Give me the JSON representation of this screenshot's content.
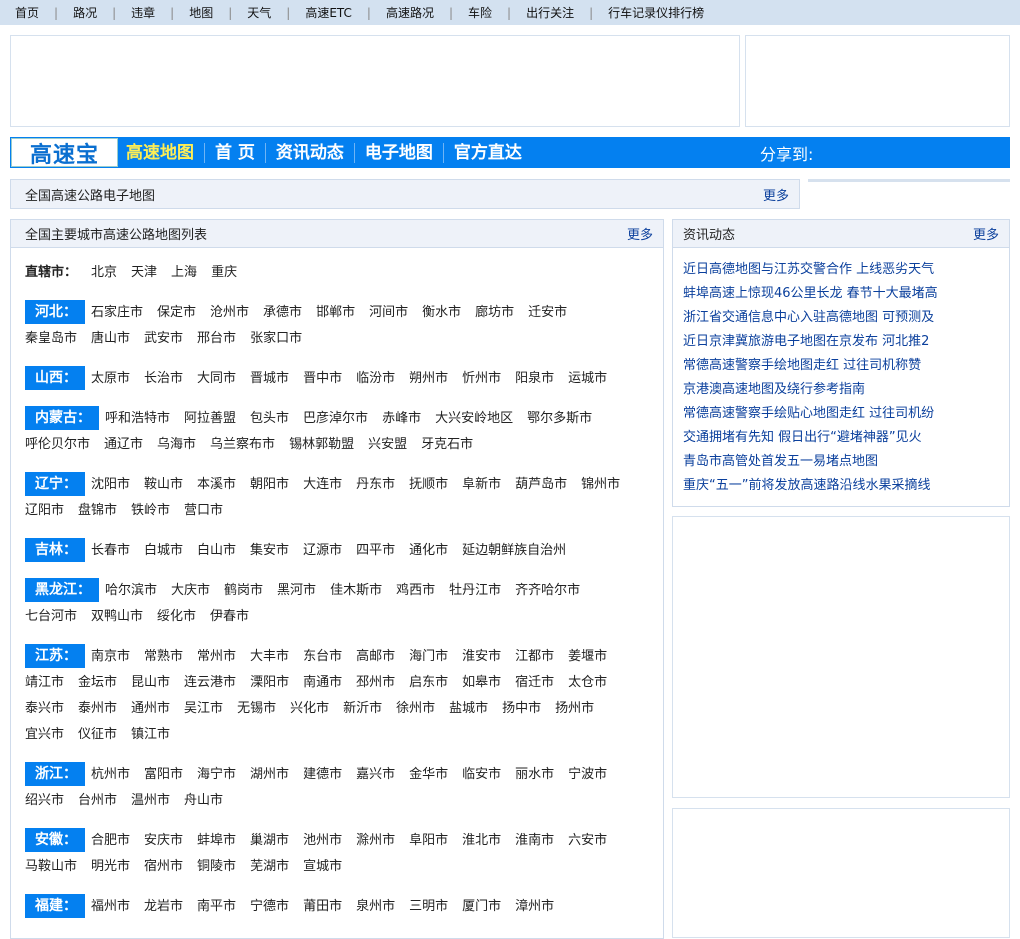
{
  "topnav": [
    "首页",
    "路况",
    "违章",
    "地图",
    "天气",
    "高速ETC",
    "高速路况",
    "车险",
    "出行关注",
    "行车记录仪排行榜"
  ],
  "mainnav": {
    "logo": "高速宝",
    "items": [
      "高速地图",
      "首 页",
      "资讯动态",
      "电子地图",
      "官方直达"
    ],
    "share": "分享到:"
  },
  "map_bar": {
    "title": "全国高速公路电子地图",
    "more": "更多"
  },
  "city_panel": {
    "title": "全国主要城市高速公路地图列表",
    "more": "更多",
    "direct": {
      "label": "直辖市：",
      "cities": [
        "北京",
        "天津",
        "上海",
        "重庆"
      ]
    },
    "provinces": [
      {
        "label": "河北：",
        "cities": [
          "石家庄市",
          "保定市",
          "沧州市",
          "承德市",
          "邯郸市",
          "河间市",
          "衡水市",
          "廊坊市",
          "迁安市",
          "秦皇岛市",
          "唐山市",
          "武安市",
          "邢台市",
          "张家口市"
        ]
      },
      {
        "label": "山西：",
        "cities": [
          "太原市",
          "长治市",
          "大同市",
          "晋城市",
          "晋中市",
          "临汾市",
          "朔州市",
          "忻州市",
          "阳泉市",
          "运城市"
        ]
      },
      {
        "label": "内蒙古：",
        "cities": [
          "呼和浩特市",
          "阿拉善盟",
          "包头市",
          "巴彦淖尔市",
          "赤峰市",
          "大兴安岭地区",
          "鄂尔多斯市",
          "呼伦贝尔市",
          "通辽市",
          "乌海市",
          "乌兰察布市",
          "锡林郭勒盟",
          "兴安盟",
          "牙克石市"
        ]
      },
      {
        "label": "辽宁：",
        "cities": [
          "沈阳市",
          "鞍山市",
          "本溪市",
          "朝阳市",
          "大连市",
          "丹东市",
          "抚顺市",
          "阜新市",
          "葫芦岛市",
          "锦州市",
          "辽阳市",
          "盘锦市",
          "铁岭市",
          "营口市"
        ]
      },
      {
        "label": "吉林：",
        "cities": [
          "长春市",
          "白城市",
          "白山市",
          "集安市",
          "辽源市",
          "四平市",
          "通化市",
          "延边朝鲜族自治州"
        ]
      },
      {
        "label": "黑龙江：",
        "cities": [
          "哈尔滨市",
          "大庆市",
          "鹤岗市",
          "黑河市",
          "佳木斯市",
          "鸡西市",
          "牡丹江市",
          "齐齐哈尔市",
          "七台河市",
          "双鸭山市",
          "绥化市",
          "伊春市"
        ]
      },
      {
        "label": "江苏：",
        "cities": [
          "南京市",
          "常熟市",
          "常州市",
          "大丰市",
          "东台市",
          "高邮市",
          "海门市",
          "淮安市",
          "江都市",
          "姜堰市",
          "靖江市",
          "金坛市",
          "昆山市",
          "连云港市",
          "溧阳市",
          "南通市",
          "邳州市",
          "启东市",
          "如皋市",
          "宿迁市",
          "太仓市",
          "泰兴市",
          "泰州市",
          "通州市",
          "吴江市",
          "无锡市",
          "兴化市",
          "新沂市",
          "徐州市",
          "盐城市",
          "扬中市",
          "扬州市",
          "宜兴市",
          "仪征市",
          "镇江市"
        ]
      },
      {
        "label": "浙江：",
        "cities": [
          "杭州市",
          "富阳市",
          "海宁市",
          "湖州市",
          "建德市",
          "嘉兴市",
          "金华市",
          "临安市",
          "丽水市",
          "宁波市",
          "绍兴市",
          "台州市",
          "温州市",
          "舟山市"
        ]
      },
      {
        "label": "安徽：",
        "cities": [
          "合肥市",
          "安庆市",
          "蚌埠市",
          "巢湖市",
          "池州市",
          "滁州市",
          "阜阳市",
          "淮北市",
          "淮南市",
          "六安市",
          "马鞍山市",
          "明光市",
          "宿州市",
          "铜陵市",
          "芜湖市",
          "宣城市"
        ]
      },
      {
        "label": "福建：",
        "cities": [
          "福州市",
          "龙岩市",
          "南平市",
          "宁德市",
          "莆田市",
          "泉州市",
          "三明市",
          "厦门市",
          "漳州市"
        ]
      }
    ]
  },
  "news_panel": {
    "title": "资讯动态",
    "more": "更多",
    "items": [
      "近日高德地图与江苏交警合作 上线恶劣天气",
      "蚌埠高速上惊现46公里长龙 春节十大最堵高",
      "浙江省交通信息中心入驻高德地图 可预测及",
      "近日京津冀旅游电子地图在京发布 河北推2",
      "常德高速警察手绘地图走红 过往司机称赞",
      "京港澳高速地图及绕行参考指南",
      "常德高速警察手绘贴心地图走红 过往司机纷",
      "交通拥堵有先知 假日出行“避堵神器”见火",
      "青岛市高管处首发五一易堵点地图",
      "重庆“五一”前将发放高速路沿线水果采摘线"
    ]
  }
}
